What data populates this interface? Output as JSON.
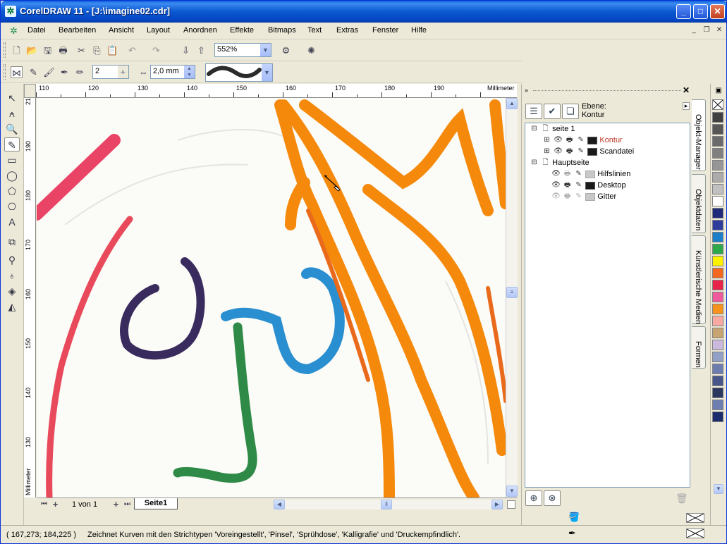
{
  "window": {
    "title": "CorelDRAW 11 - [J:\\imagine02.cdr]",
    "controls": {
      "minimize": "_",
      "maximize": "□",
      "close": "✕"
    }
  },
  "menu": {
    "items": [
      "Datei",
      "Bearbeiten",
      "Ansicht",
      "Layout",
      "Anordnen",
      "Effekte",
      "Bitmaps",
      "Text",
      "Extras",
      "Fenster",
      "Hilfe"
    ]
  },
  "toolbar": {
    "zoom_value": "552%"
  },
  "property_bar": {
    "smoothing_value": "2",
    "width_value": "2,0 mm"
  },
  "ruler": {
    "unit": "Millimeter",
    "h_ticks": [
      "110",
      "120",
      "130",
      "140",
      "150",
      "160",
      "170",
      "180",
      "190"
    ],
    "v_ticks": [
      "190",
      "180",
      "170",
      "160",
      "150",
      "140",
      "130"
    ],
    "v_top_partial": "21"
  },
  "pages": {
    "page_counter": "1 von 1",
    "active_tab": "Seite1"
  },
  "docker": {
    "ebene_label": "Ebene:",
    "ebene_value": "Kontur",
    "tree": [
      {
        "label": "seite 1",
        "kind": "page"
      },
      {
        "label": "Kontur",
        "kind": "layer",
        "color": "#1a1a1a",
        "active": true
      },
      {
        "label": "Scandatei",
        "kind": "layer",
        "color": "#1a1a1a"
      },
      {
        "label": "Hauptseite",
        "kind": "page"
      },
      {
        "label": "Hilfslinien",
        "kind": "layer",
        "color": "#c8c8c8"
      },
      {
        "label": "Desktop",
        "kind": "layer",
        "color": "#1a1a1a"
      },
      {
        "label": "Gitter",
        "kind": "layer",
        "color": "#c8c8c8"
      }
    ],
    "active_color": "#c0392b"
  },
  "side_tabs": [
    "Objekt-Manager",
    "Objektdaten",
    "Künstlerische Medien",
    "Formen"
  ],
  "palette": {
    "colors": [
      "#404040",
      "#575757",
      "#6b6b6b",
      "#808080",
      "#969696",
      "#ababab",
      "#c0c0c0",
      "#ffffff",
      "#1f2a7a",
      "#2e3c9c",
      "#1c7fc8",
      "#2da84a",
      "#fff200",
      "#f3671f",
      "#e8234a",
      "#ee5a9c",
      "#f7931d",
      "#f8a9a4",
      "#c8a472",
      "#cbb9dd",
      "#92a0c8",
      "#6e7db0",
      "#48578a",
      "#2c3760",
      "#6d7fb0",
      "#1d2c6c"
    ]
  },
  "status": {
    "coords": "( 167,273; 184,225 )",
    "message": "Zeichnet Kurven mit den Strichtypen 'Voreingestellt', 'Pinsel', 'Sprühdose', 'Kalligrafie' und 'Druckempfindlich'."
  }
}
